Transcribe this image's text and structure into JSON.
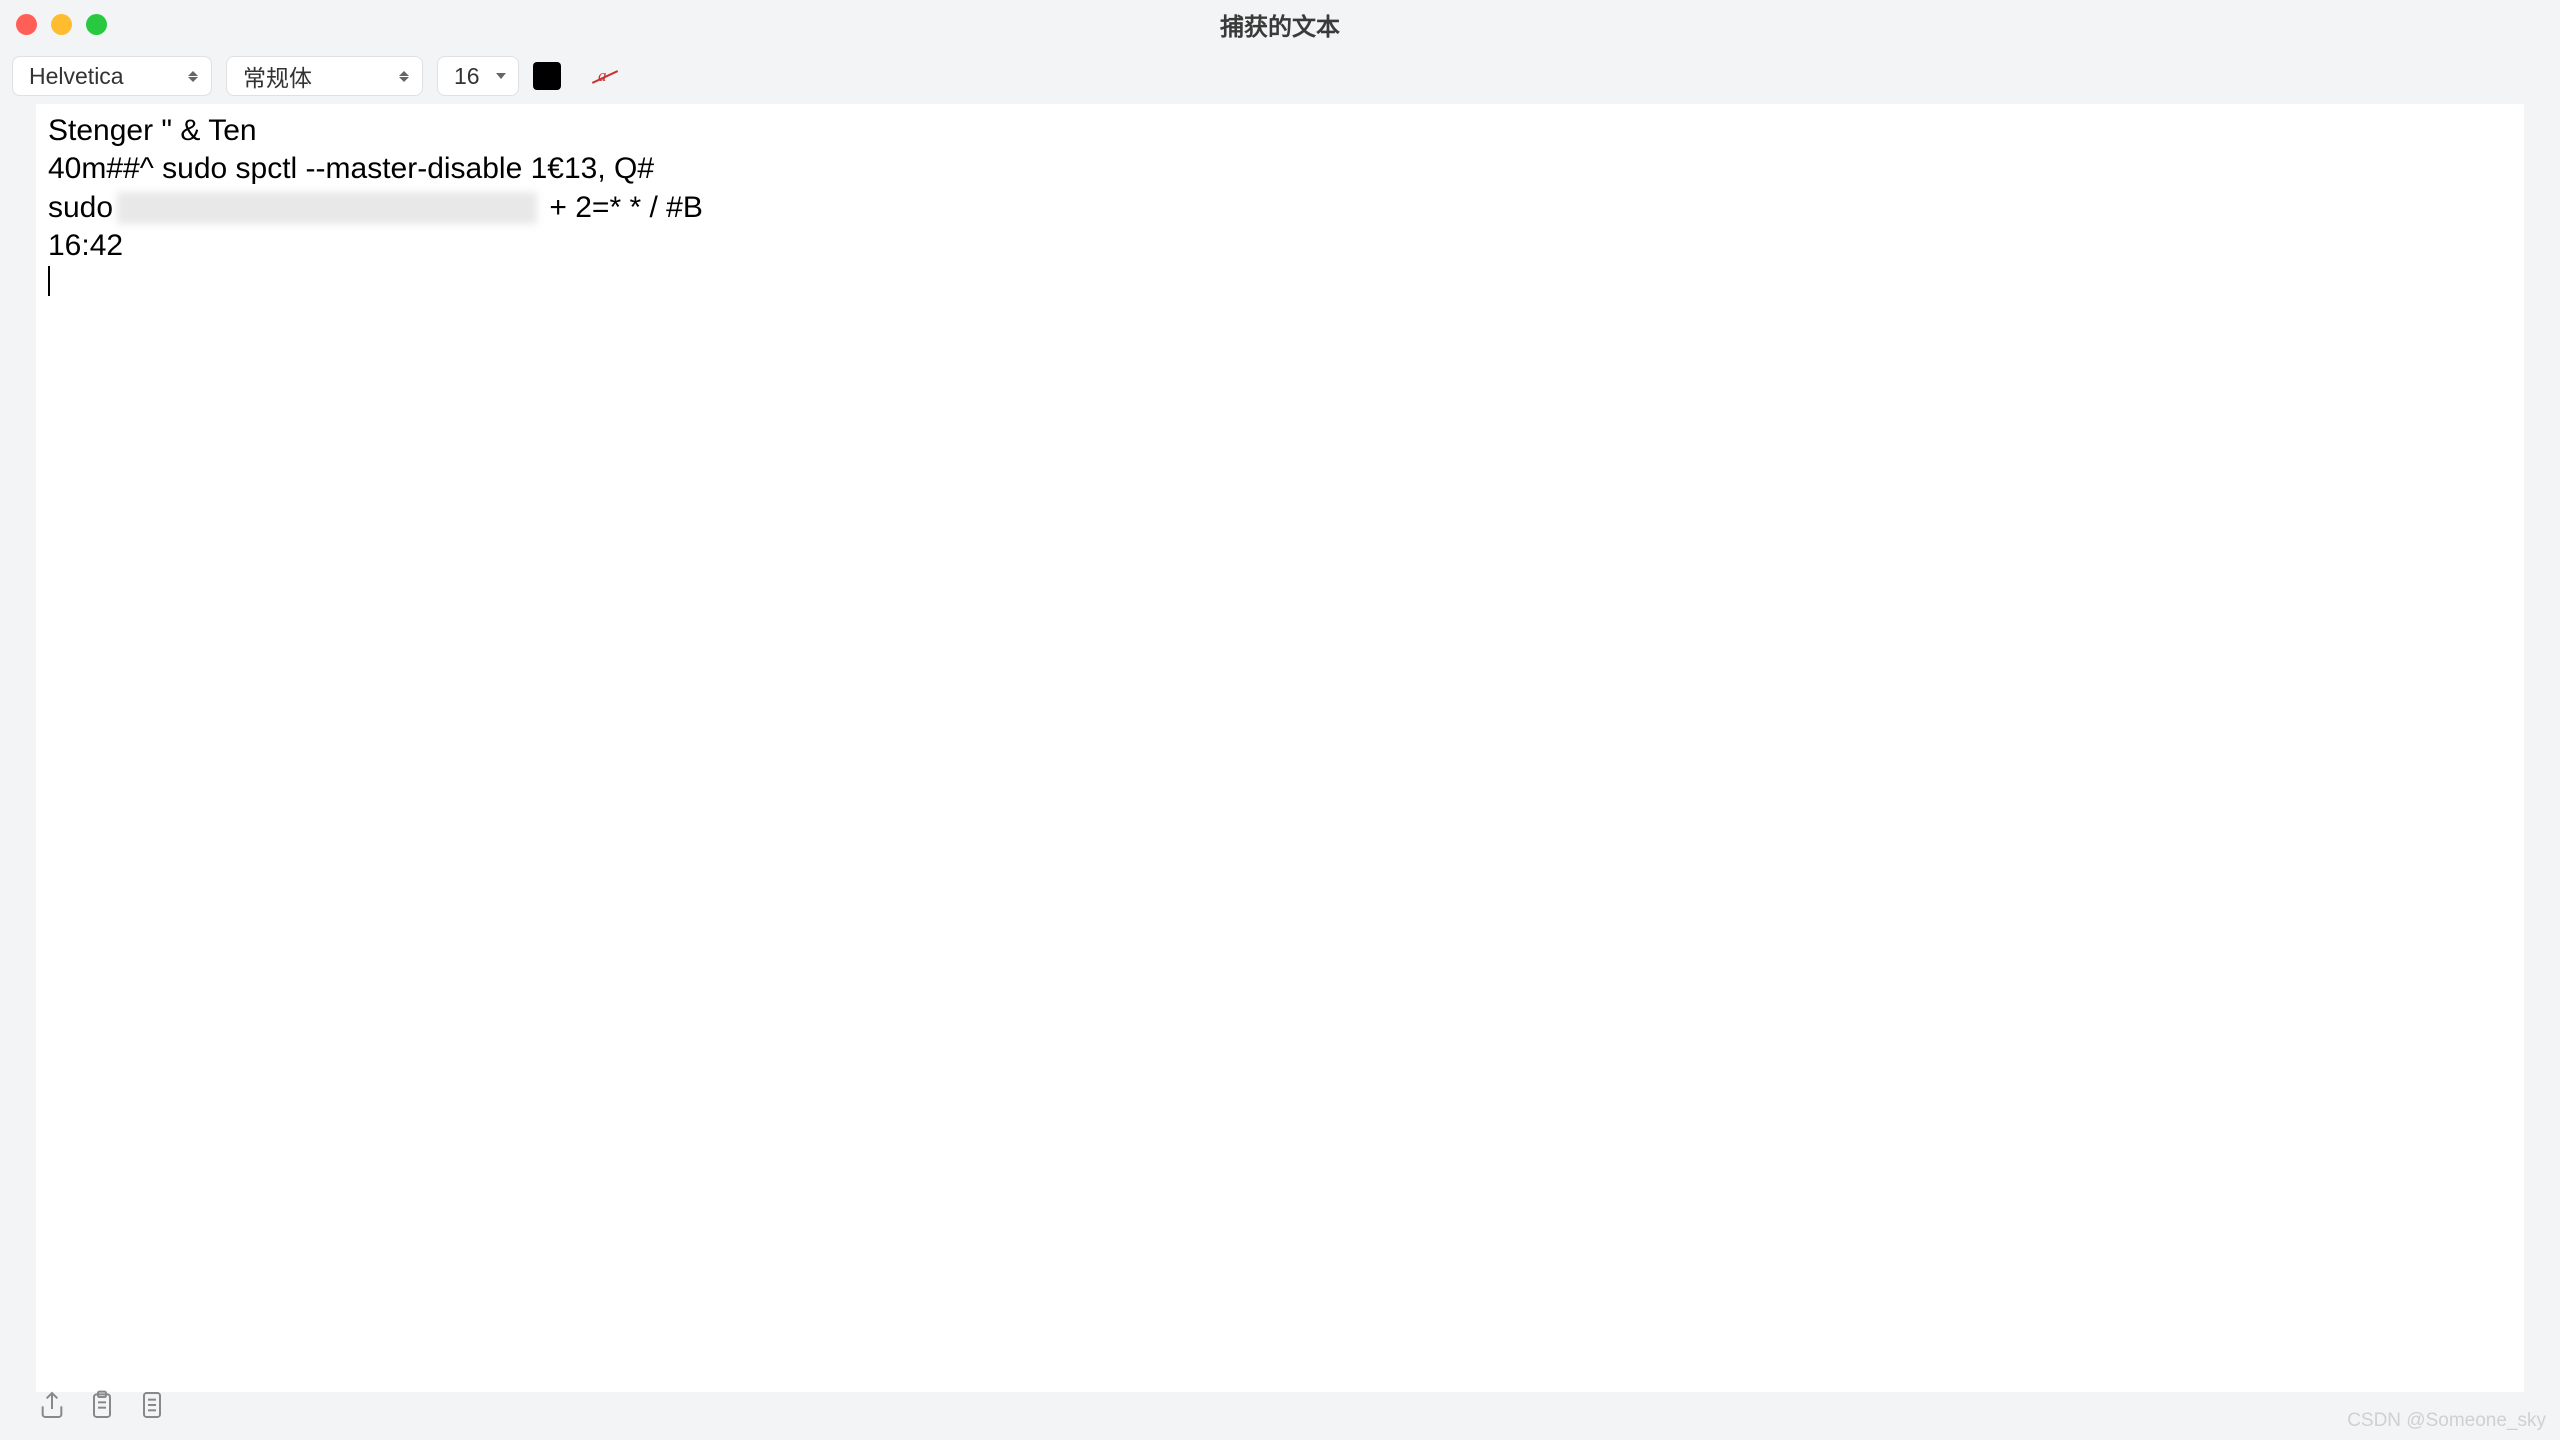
{
  "window": {
    "title": "捕获的文本"
  },
  "toolbar": {
    "font_family": "Helvetica",
    "font_style": "常规体",
    "font_size": "16",
    "text_color": "#000000"
  },
  "editor": {
    "lines": [
      "Stenger \" & Ten",
      "40m##^ sudo spctl --master-disable 1€13, Q#",
      "sudo",
      " + 2=* * / #B",
      "16:42"
    ]
  },
  "icons": {
    "share": "share-icon",
    "clipboard": "clipboard-icon",
    "document": "document-icon",
    "highlight": "highlight-icon"
  },
  "watermark": "CSDN @Someone_sky"
}
